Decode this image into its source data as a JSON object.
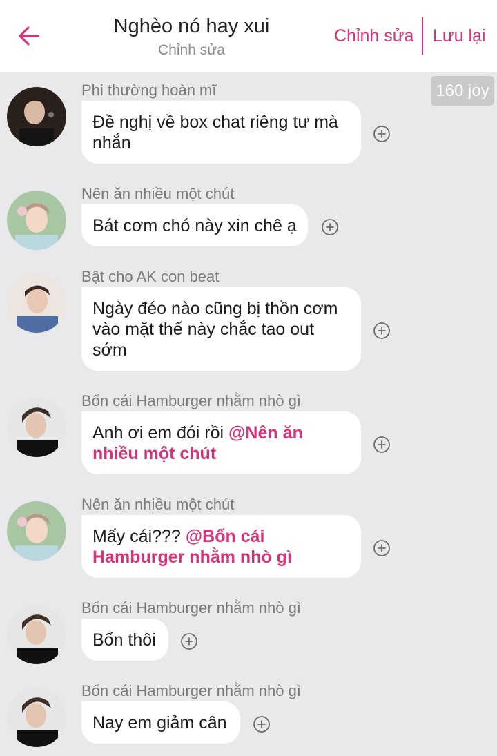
{
  "header": {
    "title": "Nghèo nó hay xui",
    "subtitle": "Chỉnh sửa",
    "edit_label": "Chỉnh sửa",
    "save_label": "Lưu lại"
  },
  "joy_badge": "160 joy",
  "accent_color": "#d6337a",
  "messages": [
    {
      "sender": "Phi thường hoàn mĩ",
      "text": "Đề nghị về box chat riêng tư mà nhắn"
    },
    {
      "sender": "Nên ăn nhiều một chút",
      "text": "Bát cơm chó này xin chê ạ"
    },
    {
      "sender": "Bật cho AK con beat",
      "text": "Ngày đéo nào cũng bị thồn cơm vào mặt thế này chắc tao out sớm"
    },
    {
      "sender": "Bốn cái Hamburger nhằm nhò gì",
      "text": "Anh ơi em đói rồi ",
      "mention": "@Nên ăn nhiều một chút"
    },
    {
      "sender": "Nên ăn nhiều một chút",
      "text": "Mấy cái??? ",
      "mention": "@Bốn cái Hamburger nhằm nhò gì"
    },
    {
      "sender": "Bốn cái Hamburger nhằm nhò gì",
      "text": "Bốn thôi"
    },
    {
      "sender": "Bốn cái Hamburger nhằm nhò gì",
      "text": "Nay em giảm cân"
    }
  ]
}
